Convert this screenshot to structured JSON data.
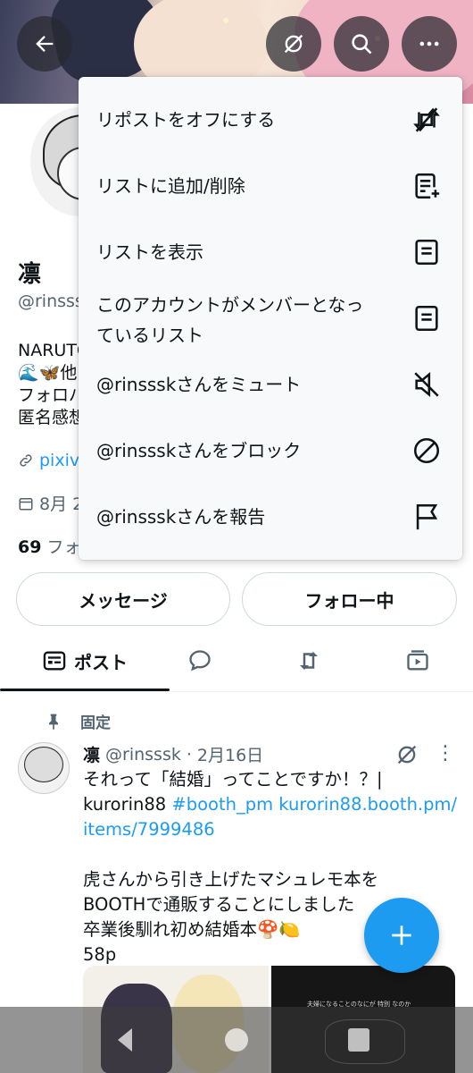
{
  "header": {
    "back_icon": "arrow-left-icon",
    "repost_off_icon": "repost-off-icon",
    "search_icon": "search-icon",
    "more_icon": "more-icon"
  },
  "profile": {
    "name": "凛",
    "handle": "@rinsss",
    "bio_lines": [
      "NARUTO",
      "🌊🦋他",
      "フォロバ",
      "匿名感想"
    ],
    "link": "pixiv.n",
    "joined": "8月 20",
    "followers_count": "69",
    "followers_label": "フォロ"
  },
  "actions": {
    "message_label": "メッセージ",
    "following_label": "フォロー中"
  },
  "tabs": {
    "posts_label": "ポスト"
  },
  "menu": {
    "items": [
      {
        "label": "リポストをオフにする",
        "icon": "repost-off-icon"
      },
      {
        "label": "リストに追加/削除",
        "icon": "list-add-icon"
      },
      {
        "label": "リストを表示",
        "icon": "list-icon"
      },
      {
        "label_line1": "このアカウントがメンバーとなっ",
        "label_line2": "ているリスト",
        "icon": "list-icon"
      },
      {
        "label": "@rinssskさんをミュート",
        "icon": "mute-icon"
      },
      {
        "label": "@rinssskさんをブロック",
        "icon": "block-icon"
      },
      {
        "label": "@rinssskさんを報告",
        "icon": "flag-icon"
      }
    ]
  },
  "post": {
    "pinned_label": "固定",
    "author_name": "凛",
    "author_handle": "@rinsssk",
    "separator": "·",
    "date": "2月16日",
    "more": "⋮",
    "text_line1": "それって「結婚」ってことですか！？|",
    "text_line2_plain": "kurorin88 ",
    "text_line2_tag": "#booth_pm",
    "text_line2_link": " kurorin88.booth.pm/",
    "text_line3_link": "items/7999486",
    "text_line4": "虎さんから引き上げたマシュレモ本を",
    "text_line5": "BOOTHで通販することにしました",
    "text_line6": "卒業後馴れ初め結婚本🍄🍋",
    "text_line7": "58p",
    "media2_caption": "夫婦になることのなにが 特別 なのか"
  },
  "colors": {
    "accent": "#1d9bf0",
    "text": "#0f1419",
    "muted": "#536471",
    "menu_bg": "#f7f9fa"
  }
}
